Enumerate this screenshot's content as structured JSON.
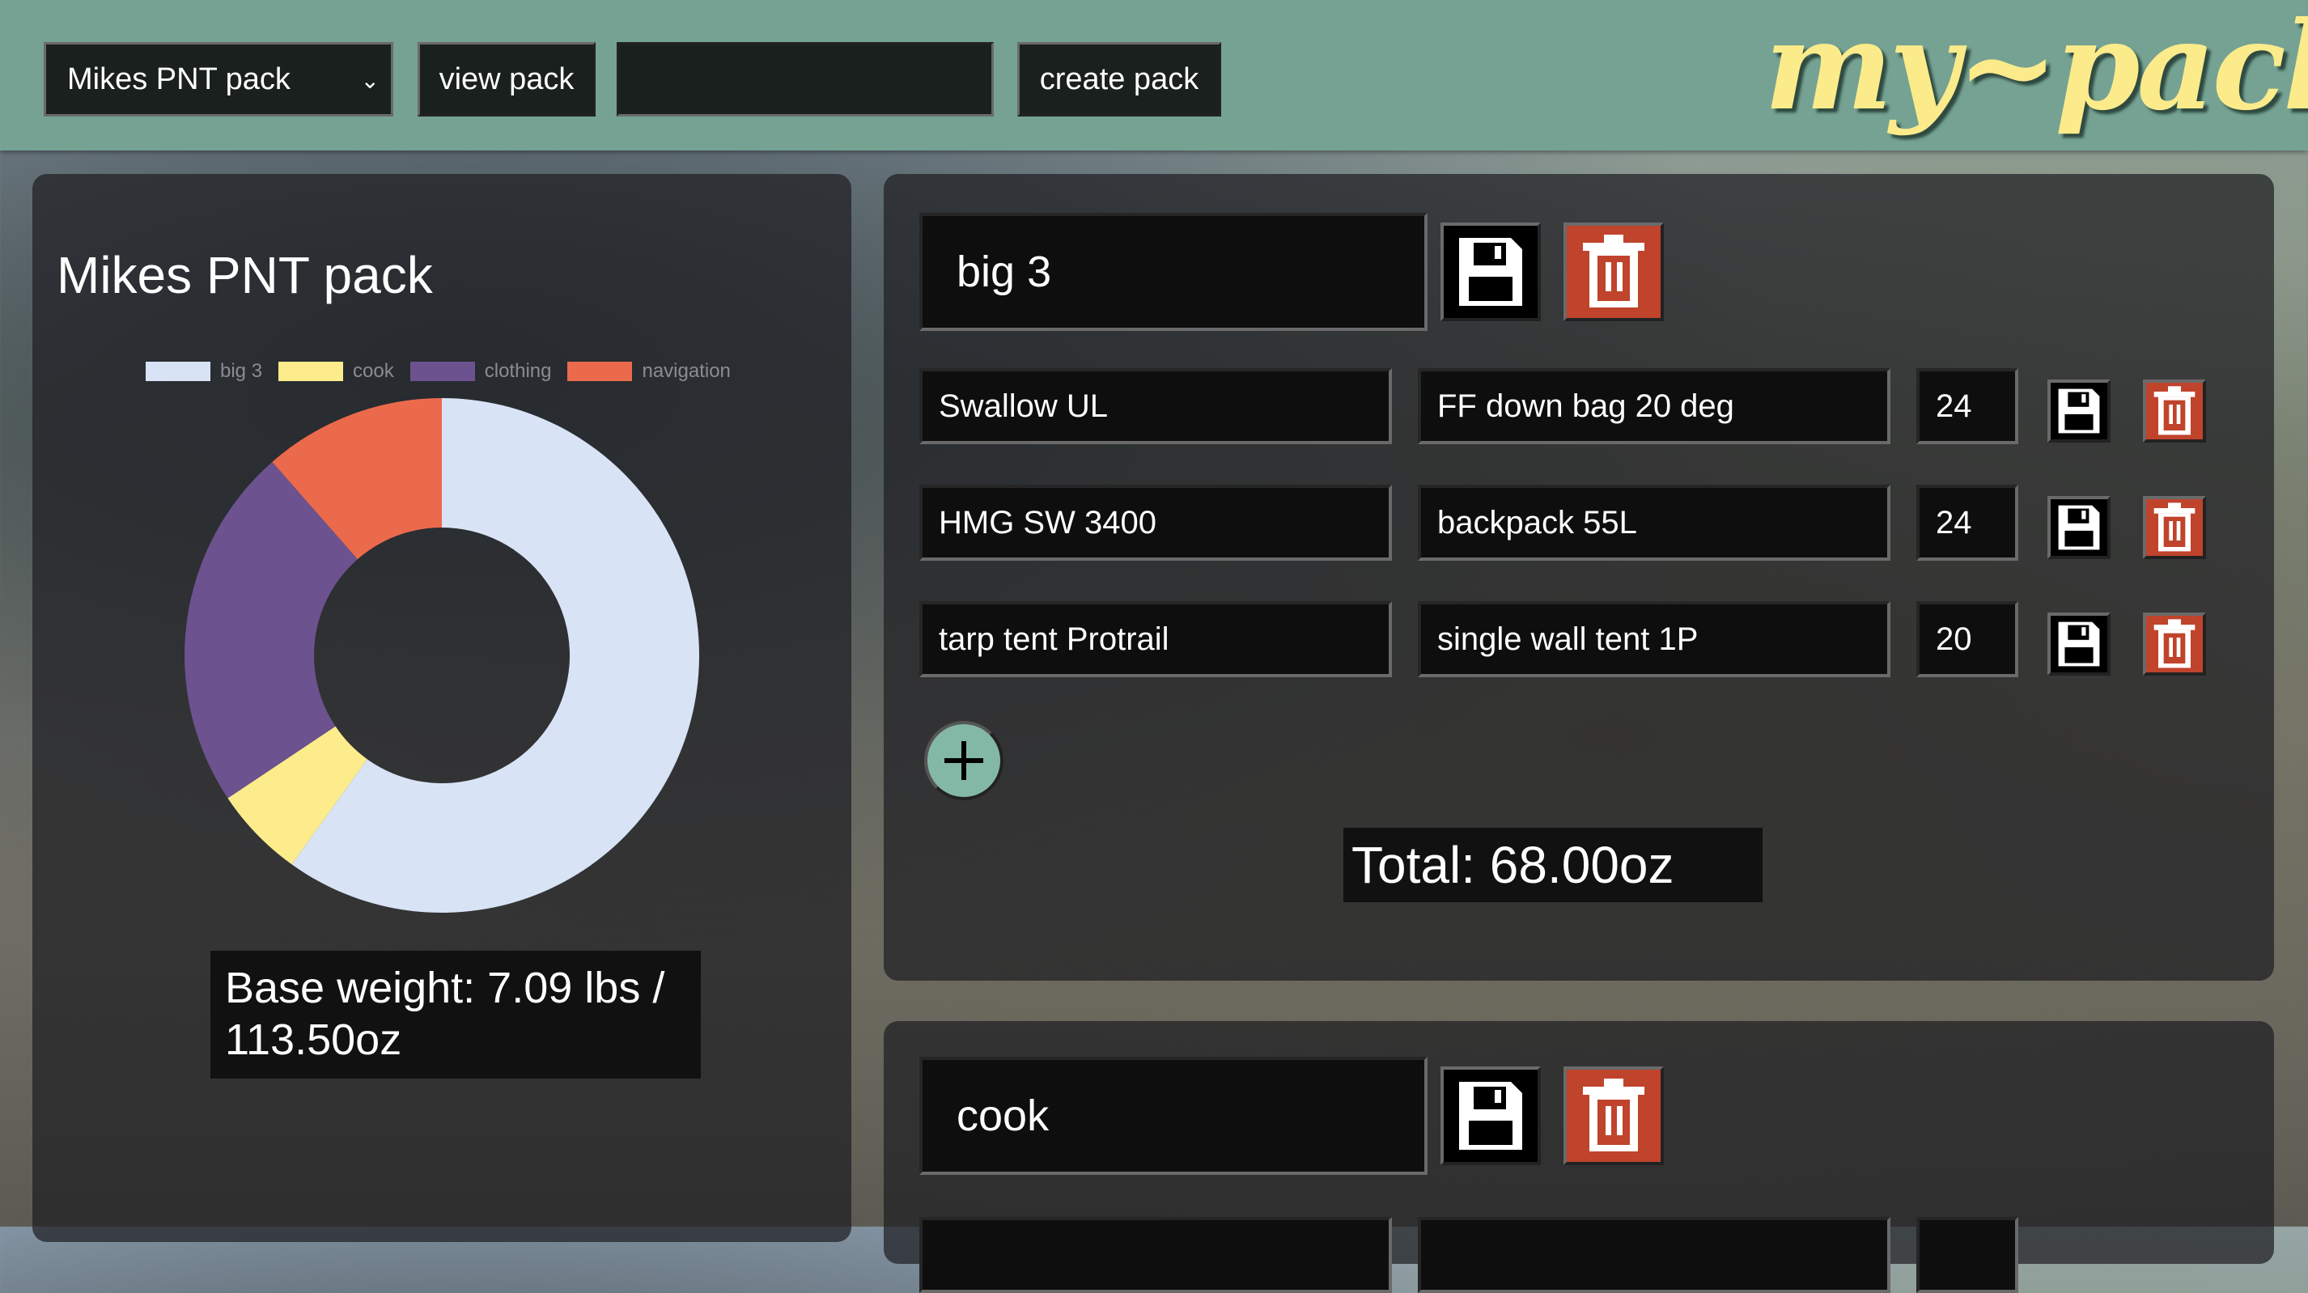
{
  "header": {
    "pack_select": {
      "selected": "Mikes PNT pack"
    },
    "view_pack_label": "view pack",
    "new_pack_input": {
      "value": "",
      "placeholder": ""
    },
    "create_pack_label": "create pack",
    "logo": "my~pack"
  },
  "summary": {
    "pack_title": "Mikes PNT pack",
    "base_weight_line1": "Base weight: 7.09 lbs /",
    "base_weight_line2": "113.50oz"
  },
  "chart_data": {
    "type": "pie",
    "variant": "donut",
    "title": "",
    "categories": [
      "big 3",
      "cook",
      "clothing",
      "navigation"
    ],
    "values": [
      68,
      6.5,
      26,
      13
    ],
    "colors": [
      "#d8e3f5",
      "#fdec8c",
      "#6c528e",
      "#eb6a4c"
    ],
    "legend_position": "top",
    "unit": "oz"
  },
  "categories": [
    {
      "name": "big 3",
      "items": [
        {
          "name": "Swallow UL",
          "description": "FF down bag 20 deg",
          "weight": "24"
        },
        {
          "name": "HMG SW 3400",
          "description": "backpack 55L",
          "weight": "24"
        },
        {
          "name": "tarp tent Protrail",
          "description": "single wall tent 1P",
          "weight": "20"
        }
      ],
      "total": "Total: 68.00oz"
    },
    {
      "name": "cook",
      "items": []
    }
  ],
  "icons": {
    "save": "floppy-disk-icon",
    "delete": "trash-icon",
    "add": "plus-icon",
    "dropdown": "chevron-down-icon"
  }
}
